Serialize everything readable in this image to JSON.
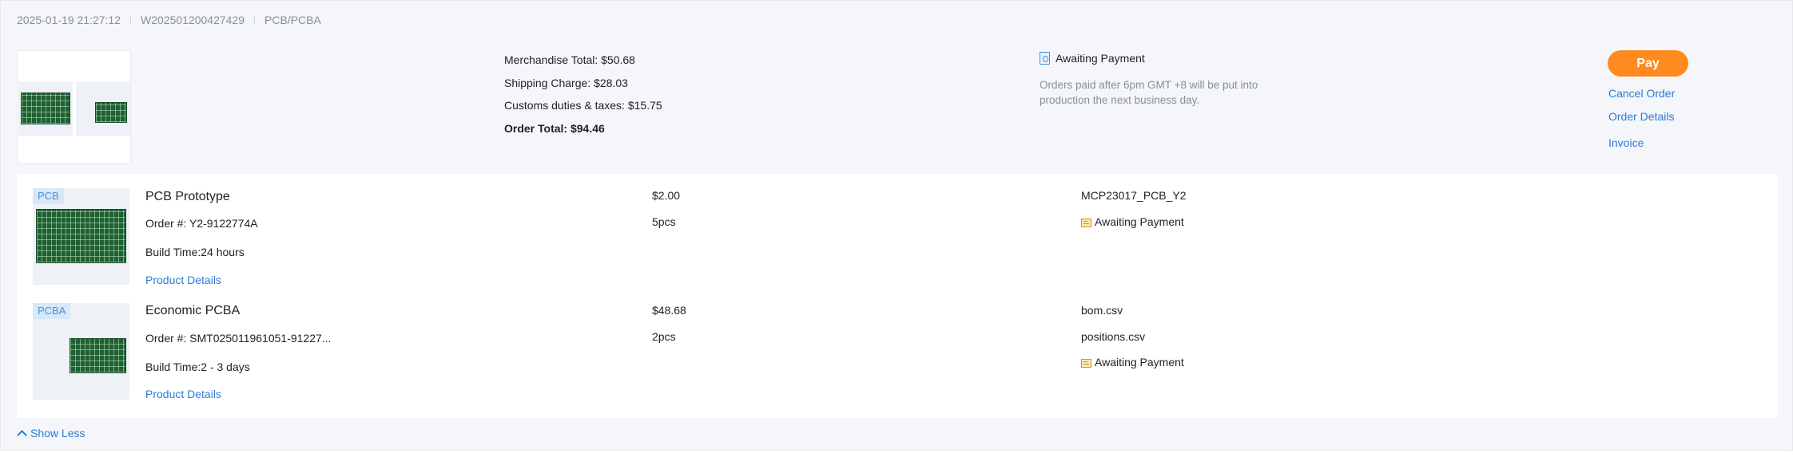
{
  "order": {
    "datetime": "2025-01-19 21:27:12",
    "order_no": "W202501200427429",
    "category": "PCB/PCBA"
  },
  "summary": {
    "merchandise_total": "Merchandise Total: $50.68",
    "shipping_charge": "Shipping Charge: $28.03",
    "customs": "Customs duties & taxes: $15.75",
    "order_total": "Order Total: $94.46",
    "status": "Awaiting Payment",
    "note": "Orders paid after 6pm GMT +8 will be put into production the next business day."
  },
  "actions": {
    "pay": "Pay",
    "cancel": "Cancel Order",
    "details": "Order Details",
    "invoice": "Invoice"
  },
  "items": [
    {
      "tag": "PCB",
      "name": "PCB Prototype",
      "order_no": "Order #: Y2-9122774A",
      "build_time": "Build Time:24 hours",
      "link": "Product Details",
      "price": "$2.00",
      "qty": "5pcs",
      "file": "MCP23017_PCB_Y2",
      "status": "Awaiting Payment"
    },
    {
      "tag": "PCBA",
      "name": "Economic PCBA",
      "order_no": "Order #: SMT025011961051-91227...",
      "build_time": "Build Time:2 - 3 days",
      "link": "Product Details",
      "price": "$48.68",
      "qty": "2pcs",
      "file1": "bom.csv",
      "file2": "positions.csv",
      "status": "Awaiting Payment"
    }
  ],
  "footer": {
    "show_less": "Show Less"
  },
  "colors": {
    "accent": "#ff8a1f",
    "link": "#2e7bd6",
    "tag_bg": "#d8e8fb",
    "board": "#1f5f33"
  }
}
